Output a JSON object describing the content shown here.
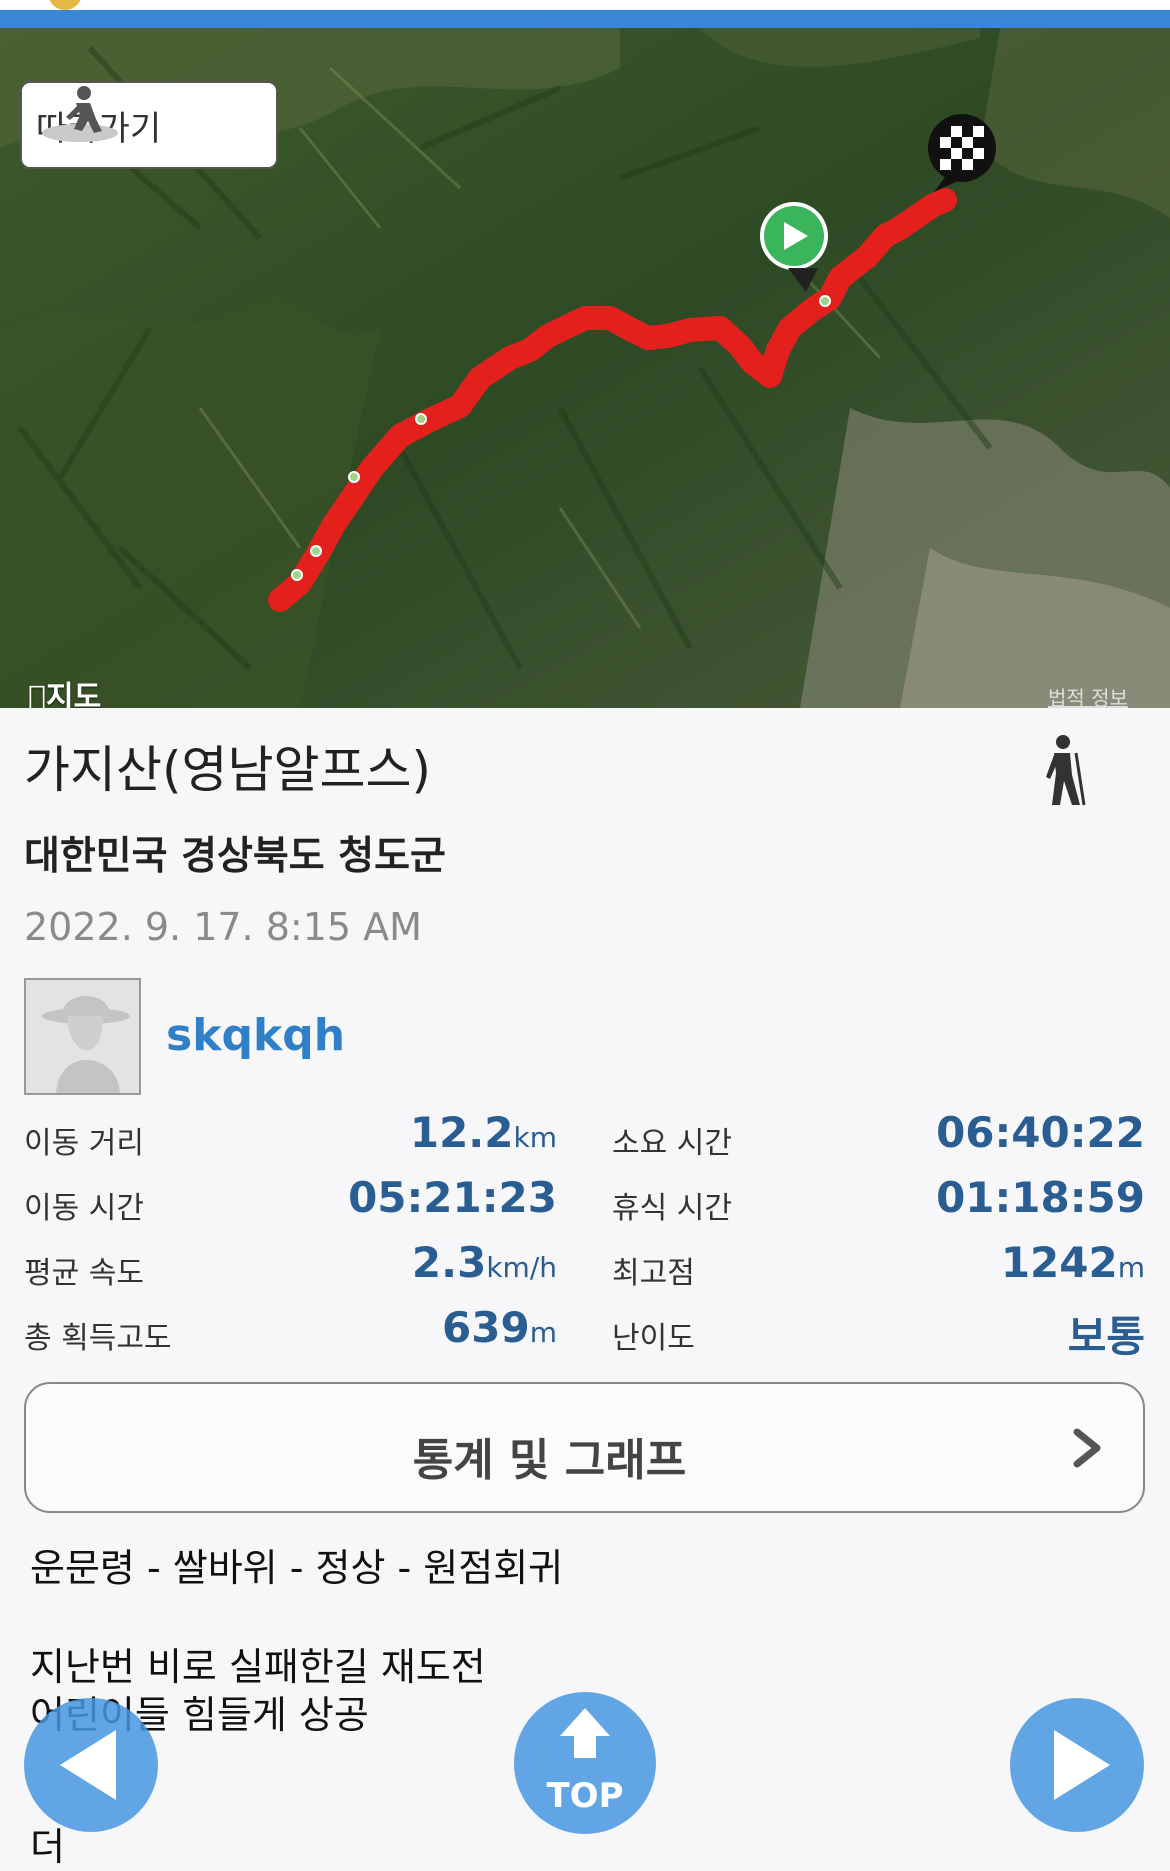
{
  "map": {
    "follow_label": "따라가기",
    "provider_label": "지도",
    "legal_label": "법적 정보"
  },
  "trip": {
    "title": "가지산(영남알프스)",
    "location": "대한민국 경상북도 청도군",
    "date": "2022. 9. 17. 8:15 AM",
    "user": "skqkqh"
  },
  "stats": {
    "distance": {
      "label": "이동 거리",
      "value": "12.2",
      "unit": "km"
    },
    "moving_time": {
      "label": "이동 시간",
      "value": "05:21:23",
      "unit": ""
    },
    "avg_speed": {
      "label": "평균 속도",
      "value": "2.3",
      "unit": "km/h"
    },
    "total_ascent": {
      "label": "총 획득고도",
      "value": "639",
      "unit": "m"
    },
    "total_time": {
      "label": "소요 시간",
      "value": "06:40:22",
      "unit": ""
    },
    "rest_time": {
      "label": "휴식 시간",
      "value": "01:18:59",
      "unit": ""
    },
    "max_elev": {
      "label": "최고점",
      "value": "1242",
      "unit": "m"
    },
    "difficulty": {
      "label": "난이도",
      "value": "보통",
      "unit": ""
    }
  },
  "stats_button_label": "통계 및 그래프",
  "description": {
    "route": "운문령 - 쌀바위 - 정상 - 원점회귀",
    "line1": "지난번 비로 실패한길 재도전",
    "line2": "어린이들 힘들게 상공",
    "line3": "더"
  },
  "nav": {
    "top_label": "TOP"
  },
  "colors": {
    "accent": "#3a86d6",
    "track": "#e3201b",
    "stat_value": "#2a5d92",
    "username": "#2f80c9"
  }
}
